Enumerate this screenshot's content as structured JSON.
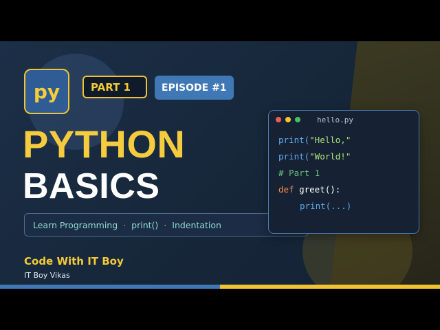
{
  "logo": {
    "text": "py"
  },
  "badges": {
    "part": "PART 1",
    "episode": "EPISODE #1"
  },
  "title": {
    "line1": "PYTHON",
    "line2": "BASICS"
  },
  "topics": [
    "Learn Programming",
    "print()",
    "Indentation"
  ],
  "topic_separator": "·",
  "channel": {
    "name": "Code With IT Boy",
    "author": "IT Boy Vikas"
  },
  "code_window": {
    "filename": "hello.py",
    "lines": {
      "l1_fn": "print(",
      "l1_str": "\"Hello,\"",
      "l2_fn": "print(",
      "l2_str": "\"World!\"",
      "l3_comment": "# Part 1",
      "l4_def": "def",
      "l4_name": " greet",
      "l4_rest": "():",
      "l5": "print(...)"
    }
  },
  "colors": {
    "accent_yellow": "#f1c232",
    "accent_blue": "#3f78b5",
    "background_navy": "#1c2f48"
  }
}
